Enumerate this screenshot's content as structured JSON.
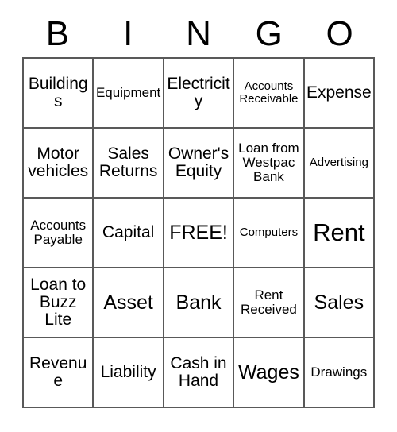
{
  "card": {
    "title_letters": [
      "B",
      "I",
      "N",
      "G",
      "O"
    ],
    "free_space_label": "FREE!",
    "border_color": "#595959",
    "text_color": "#000000",
    "background_color": "#ffffff",
    "rows": [
      [
        {
          "label": "Buildings",
          "size": "md"
        },
        {
          "label": "Equipment",
          "size": "sm"
        },
        {
          "label": "Electricity",
          "size": "md"
        },
        {
          "label": "Accounts Receivable",
          "size": "xs"
        },
        {
          "label": "Expense",
          "size": "md"
        }
      ],
      [
        {
          "label": "Motor vehicles",
          "size": "md"
        },
        {
          "label": "Sales Returns",
          "size": "md"
        },
        {
          "label": "Owner's Equity",
          "size": "md"
        },
        {
          "label": "Loan from Westpac Bank",
          "size": "sm"
        },
        {
          "label": "Advertising",
          "size": "xs"
        }
      ],
      [
        {
          "label": "Accounts Payable",
          "size": "sm"
        },
        {
          "label": "Capital",
          "size": "md"
        },
        {
          "label": "FREE!",
          "size": "lg"
        },
        {
          "label": "Computers",
          "size": "xs"
        },
        {
          "label": "Rent",
          "size": "xl"
        }
      ],
      [
        {
          "label": "Loan to Buzz Lite",
          "size": "md"
        },
        {
          "label": "Asset",
          "size": "lg"
        },
        {
          "label": "Bank",
          "size": "lg"
        },
        {
          "label": "Rent Received",
          "size": "sm"
        },
        {
          "label": "Sales",
          "size": "lg"
        }
      ],
      [
        {
          "label": "Revenue",
          "size": "md"
        },
        {
          "label": "Liability",
          "size": "md"
        },
        {
          "label": "Cash in Hand",
          "size": "md"
        },
        {
          "label": "Wages",
          "size": "lg"
        },
        {
          "label": "Drawings",
          "size": "sm"
        }
      ]
    ]
  }
}
